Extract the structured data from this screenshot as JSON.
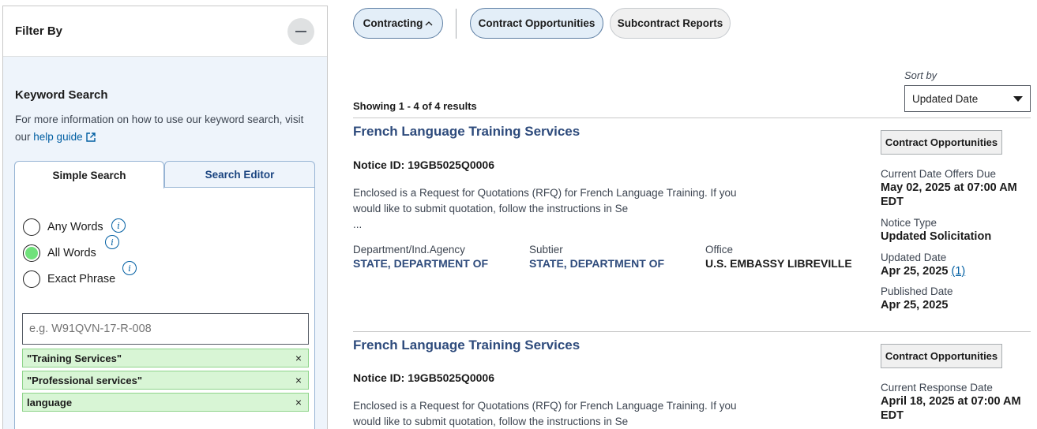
{
  "sidebar": {
    "title": "Filter By",
    "keyword": {
      "title": "Keyword Search",
      "help_text": "For more information on how to use our keyword search, visit our",
      "help_link": "help guide",
      "tabs": {
        "simple": "Simple Search",
        "editor": "Search Editor"
      },
      "options": {
        "any": "Any Words",
        "all": "All Words",
        "exact": "Exact Phrase"
      },
      "selected_option": "All Words",
      "input_placeholder": "e.g. W91QVN-17-R-008",
      "chips": [
        "\"Training Services\"",
        "\"Professional services\"",
        "language"
      ],
      "chip_remove": "×"
    }
  },
  "nav": {
    "contracting": "Contracting",
    "contract_opportunities": "Contract Opportunities",
    "subcontract_reports": "Subcontract Reports"
  },
  "sort": {
    "label": "Sort by",
    "value": "Updated Date"
  },
  "showing": "Showing 1 - 4 of 4 results",
  "results": [
    {
      "title": "French Language Training Services",
      "notice": "Notice ID: 19GB5025Q0006",
      "desc_line1": "Enclosed is a Request for Quotations (RFQ) for French Language Training.  If you",
      "desc_line2": "would like to submit quotation, follow the instructions in Se",
      "desc_more": "...",
      "dept_label": "Department/Ind.Agency",
      "dept_value": "STATE, DEPARTMENT OF",
      "subtier_label": "Subtier",
      "subtier_value": "STATE, DEPARTMENT OF",
      "office_label": "Office",
      "office_value": "U.S. EMBASSY LIBREVILLE",
      "badge": "Contract Opportunities",
      "due_label": "Current Date Offers Due",
      "due_value": "May 02, 2025 at 07:00 AM EDT",
      "type_label": "Notice Type",
      "type_value": "Updated Solicitation",
      "updated_label": "Updated Date",
      "updated_value": "Apr 25, 2025",
      "updated_count": "(1)",
      "published_label": "Published Date",
      "published_value": "Apr 25, 2025"
    },
    {
      "title": "French Language Training Services",
      "notice": "Notice ID: 19GB5025Q0006",
      "desc_line1": "Enclosed is a Request for Quotations (RFQ) for French Language Training.  If you",
      "desc_line2": "would like to submit quotation, follow the instructions in Se",
      "badge": "Contract Opportunities",
      "due_label": "Current Response Date",
      "due_value": "April 18, 2025 at 07:00 AM EDT"
    }
  ],
  "colors": {
    "link": "#2e4b7c",
    "accent": "#005ea2",
    "chip_bg": "#d8f5d5",
    "radio_checked": "#70e17b"
  },
  "icons": [
    "minus-icon",
    "external-link-icon",
    "info-icon",
    "close-icon",
    "chevron-up-icon",
    "caret-down-icon"
  ]
}
